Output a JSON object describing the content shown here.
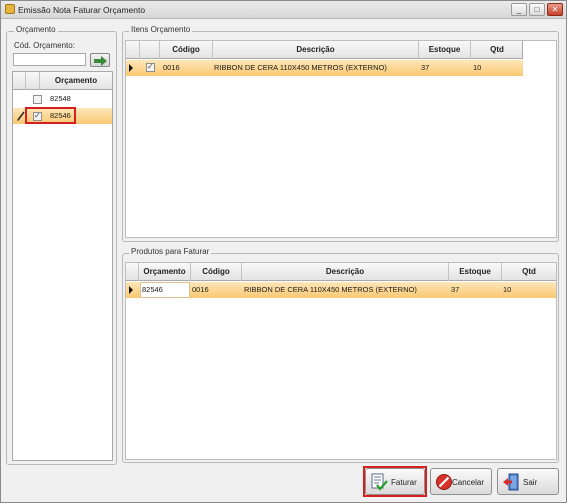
{
  "window": {
    "title": "Emissão Nota Faturar Orçamento",
    "min_label": "_",
    "max_label": "□",
    "close_label": "✕"
  },
  "left": {
    "group_label": "Orçamento",
    "field_label": "Cód. Orçamento:",
    "field_value": "",
    "go_button_icon": "arrow-right-icon",
    "grid_header": "Orçamento",
    "rows": [
      {
        "value": "82548",
        "checked": false
      },
      {
        "value": "82546",
        "checked": true
      }
    ]
  },
  "items": {
    "group_label": "Itens Orçamento",
    "columns": [
      "Código",
      "Descrição",
      "Estoque",
      "Qtd"
    ],
    "rows": [
      {
        "codigo": "0016",
        "descricao": "RIBBON DE CERA 110X450 METROS (EXTERNO)",
        "estoque": "37",
        "qtd": "10"
      }
    ]
  },
  "produtos": {
    "group_label": "Produtos para Faturar",
    "columns": [
      "Orçamento",
      "Código",
      "Descrição",
      "Estoque",
      "Qtd"
    ],
    "rows": [
      {
        "orcamento": "82546",
        "codigo": "0016",
        "descricao": "RIBBON DE CERA 110X450 METROS (EXTERNO)",
        "estoque": "37",
        "qtd": "10"
      }
    ]
  },
  "buttons": {
    "faturar": "Faturar",
    "cancelar": "Cancelar",
    "sair": "Sair"
  }
}
